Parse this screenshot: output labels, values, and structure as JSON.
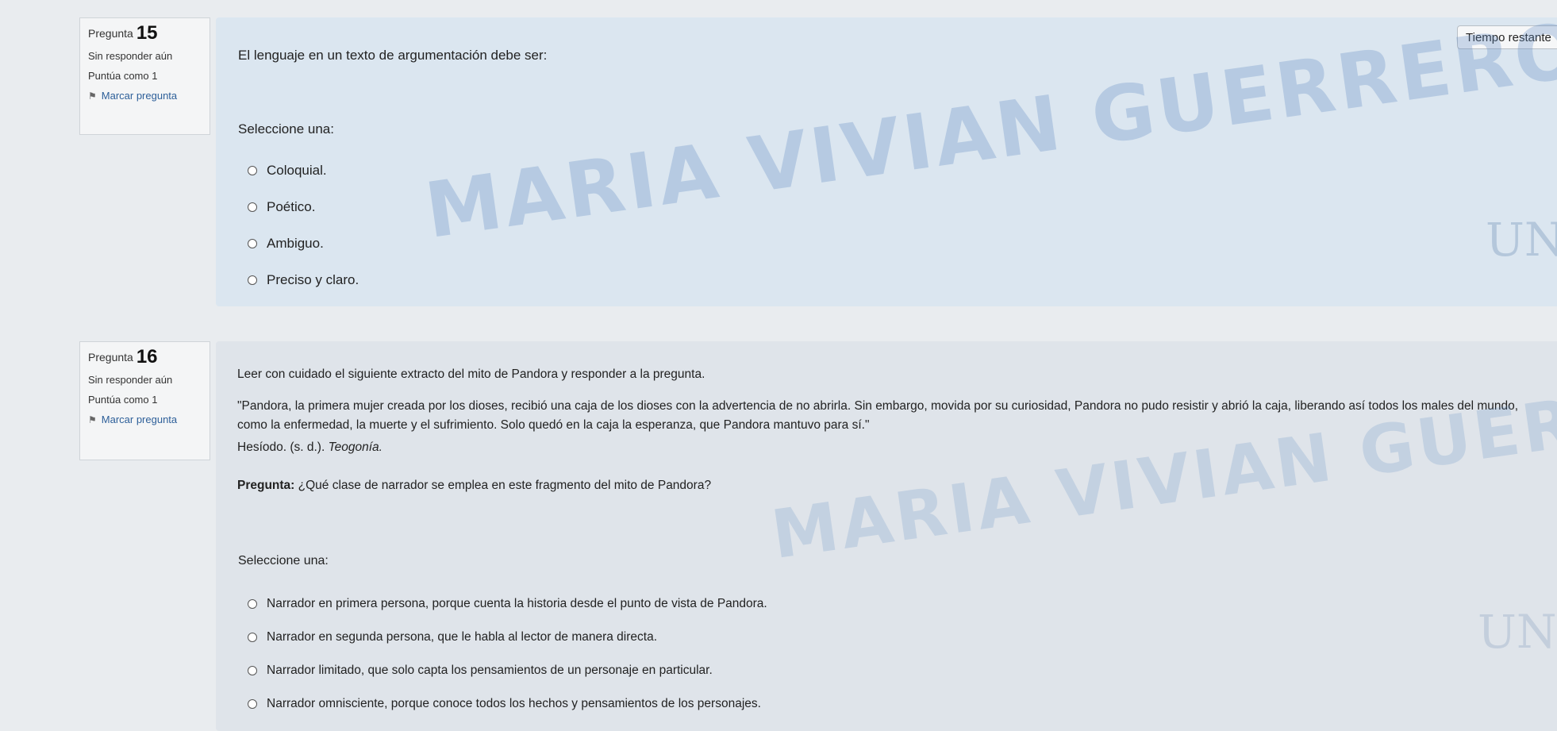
{
  "watermark": {
    "text": "MARIA VIVIAN GUERRERO VILORIA",
    "logo_text": "UN"
  },
  "timer": {
    "label": "Tiempo restante"
  },
  "questions": [
    {
      "label": "Pregunta",
      "number": "15",
      "status": "Sin responder aún",
      "points": "Puntúa como 1",
      "flag_label": "Marcar pregunta",
      "text": "El lenguaje en un texto de argumentación debe ser:",
      "prompt": "Seleccione una:",
      "options": [
        "Coloquial.",
        "Poético.",
        "Ambiguo.",
        "Preciso y claro."
      ]
    },
    {
      "label": "Pregunta",
      "number": "16",
      "status": "Sin responder aún",
      "points": "Puntúa como 1",
      "flag_label": "Marcar pregunta",
      "intro": "Leer con cuidado el siguiente extracto del mito de Pandora y responder a la pregunta.",
      "quote": "\"Pandora, la primera mujer creada por los dioses, recibió una caja de los dioses con la advertencia de no abrirla. Sin embargo, movida por su curiosidad, Pandora no pudo resistir y abrió la caja, liberando así todos los males del mundo, como la enfermedad, la muerte y el sufrimiento. Solo quedó en la caja la esperanza, que Pandora mantuvo para sí.\"",
      "citation_author": "Hesíodo. (s. d.).",
      "citation_title": "Teogonía.",
      "question_label": "Pregunta:",
      "question_text": "¿Qué clase de narrador se emplea en este fragmento del mito de Pandora?",
      "prompt": "Seleccione una:",
      "options": [
        "Narrador en primera persona, porque cuenta la historia desde el punto de vista de Pandora.",
        "Narrador en segunda persona, que le habla al lector de manera directa.",
        "Narrador limitado, que solo capta los pensamientos de un personaje en particular.",
        "Narrador omnisciente, porque conoce todos los hechos y pensamientos de los personajes."
      ]
    }
  ]
}
